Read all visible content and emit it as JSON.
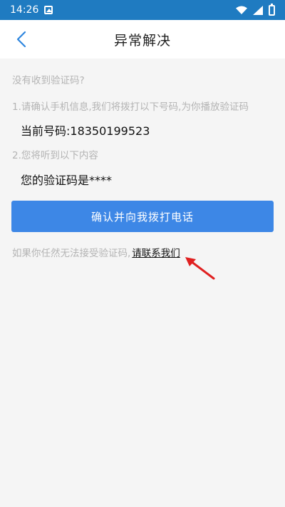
{
  "status_bar": {
    "time": "14:26",
    "icons": [
      "photo-icon",
      "wifi-icon",
      "signal-icon",
      "battery-icon"
    ]
  },
  "header": {
    "title": "异常解决",
    "back_icon": "chevron-left-icon"
  },
  "main": {
    "no_code_question": "没有收到验证码?",
    "step1": "1.请确认手机信息,我们将拨打以下号码,为你播放验证码",
    "current_number": "当前号码:18350199523",
    "step2": "2.您将听到以下内容",
    "code_message": "您的验证码是****",
    "call_button_label": "确认并向我拨打电话",
    "help_text": "如果你任然无法接受验证码,",
    "contact_link": "请联系我们"
  },
  "colors": {
    "status_bar": "#1f7bc1",
    "primary_button": "#3d87e6",
    "hint_text": "#b4b4b4",
    "annotation_arrow": "#e02020"
  }
}
